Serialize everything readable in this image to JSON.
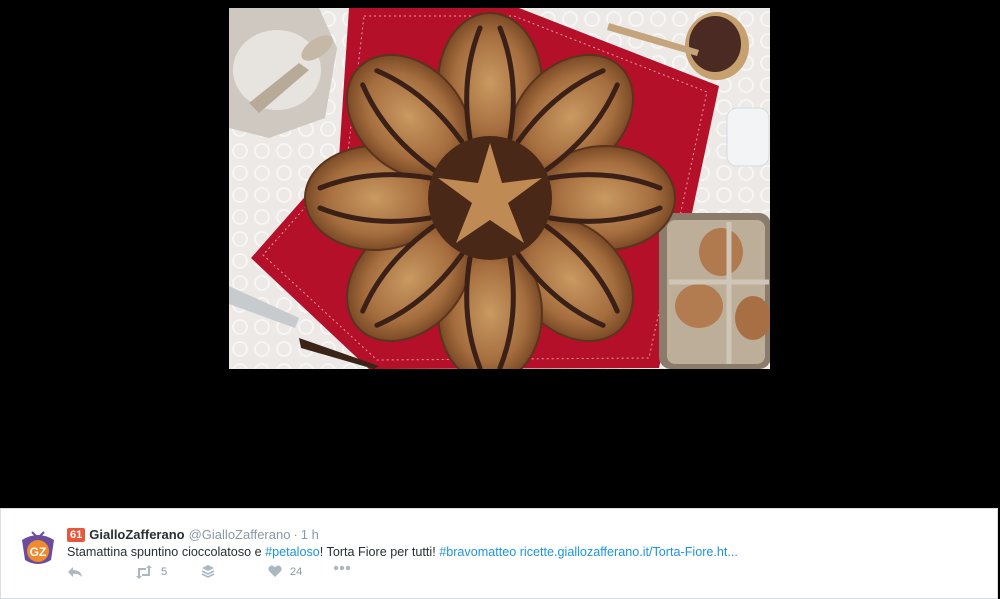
{
  "tweet": {
    "badge_count": "61",
    "display_name": "GialloZafferano",
    "handle": "@GialloZafferano",
    "separator": "·",
    "time": "1 h",
    "text_before": "Stamattina spuntino cioccolatoso e ",
    "hashtag1": "#petaloso",
    "text_middle": "! Torta Fiore per tutti! ",
    "hashtag2": "#bravomatteo",
    "url_text": "ricette.giallozafferano.it/Torta-Fiore.ht...",
    "avatar_letters": "GZ"
  },
  "actions": {
    "reply_icon": "reply-icon",
    "retweet_icon": "retweet-icon",
    "retweet_count": "5",
    "save_icon": "stack-icon",
    "like_icon": "heart-icon",
    "like_count": "24",
    "more_icon": "ellipsis-icon"
  },
  "colors": {
    "link": "#1b95e0",
    "muted": "#8899a6",
    "text": "#292f33",
    "badge": "#e8563c",
    "avatar_purple": "#6a4c9c",
    "avatar_orange": "#f08a2c"
  }
}
